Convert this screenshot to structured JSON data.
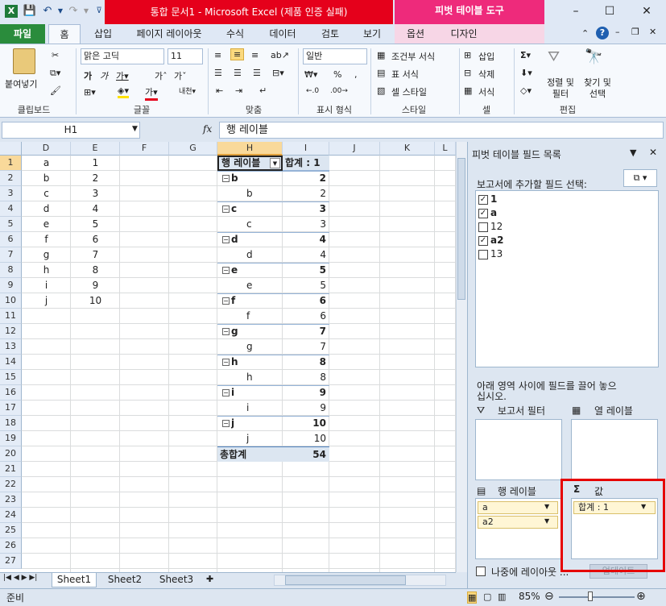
{
  "window": {
    "title": "통합 문서1 - Microsoft Excel (제품 인증 실패)",
    "contextual_tool_title": "피벗 테이블 도구",
    "min_label": "–",
    "max_label": "☐",
    "close_label": "✕"
  },
  "tabs": {
    "file": "파일",
    "home": "홈",
    "insert": "삽입",
    "page_layout": "페이지 레이아웃",
    "formulas": "수식",
    "data": "데이터",
    "review": "검토",
    "view": "보기",
    "options": "옵션",
    "design": "디자인"
  },
  "ribbon": {
    "paste": "붙여넣기",
    "font_name": "맑은 고딕",
    "font_size": "11",
    "number_format": "일반",
    "conditional_format": "조건부 서식",
    "table_format": "표 서식",
    "cell_style": "셀 스타일",
    "insert_cells": "삽입",
    "delete_cells": "삭제",
    "format_cells": "서식",
    "sort_filter": "정렬 및 필터",
    "find_select": "찾기 및 선택",
    "groups": {
      "clipboard": "클립보드",
      "font": "글꼴",
      "alignment": "맞춤",
      "number": "표시 형식",
      "styles": "스타일",
      "cells": "셀",
      "editing": "편집"
    }
  },
  "formula_bar": {
    "name_box": "H1",
    "fx": "fx",
    "content": "행 레이블"
  },
  "grid": {
    "columns": [
      "D",
      "E",
      "F",
      "G",
      "H",
      "I",
      "J",
      "K",
      "L"
    ],
    "rows": [
      "1",
      "2",
      "3",
      "4",
      "5",
      "6",
      "7",
      "8",
      "9",
      "10",
      "11",
      "12",
      "13",
      "14",
      "15",
      "16",
      "17",
      "18",
      "19",
      "20",
      "21",
      "22",
      "23",
      "24",
      "25",
      "26",
      "27"
    ],
    "col_d": [
      "a",
      "b",
      "c",
      "d",
      "e",
      "f",
      "g",
      "h",
      "i",
      "j"
    ],
    "col_e": [
      "1",
      "2",
      "3",
      "4",
      "5",
      "6",
      "7",
      "8",
      "9",
      "10"
    ],
    "pivot_header_label": "행 레이블",
    "pivot_header_value": "합계 : 1",
    "pivot_rows": [
      {
        "label": "b",
        "value": "2",
        "bold": true
      },
      {
        "label": "b",
        "value": "2",
        "bold": false
      },
      {
        "label": "c",
        "value": "3",
        "bold": true
      },
      {
        "label": "c",
        "value": "3",
        "bold": false
      },
      {
        "label": "d",
        "value": "4",
        "bold": true
      },
      {
        "label": "d",
        "value": "4",
        "bold": false
      },
      {
        "label": "e",
        "value": "5",
        "bold": true
      },
      {
        "label": "e",
        "value": "5",
        "bold": false
      },
      {
        "label": "f",
        "value": "6",
        "bold": true
      },
      {
        "label": "f",
        "value": "6",
        "bold": false
      },
      {
        "label": "g",
        "value": "7",
        "bold": true
      },
      {
        "label": "g",
        "value": "7",
        "bold": false
      },
      {
        "label": "h",
        "value": "8",
        "bold": true
      },
      {
        "label": "h",
        "value": "8",
        "bold": false
      },
      {
        "label": "i",
        "value": "9",
        "bold": true
      },
      {
        "label": "i",
        "value": "9",
        "bold": false
      },
      {
        "label": "j",
        "value": "10",
        "bold": true
      },
      {
        "label": "j",
        "value": "10",
        "bold": false
      }
    ],
    "grand_total_label": "총합계",
    "grand_total_value": "54"
  },
  "sheets": [
    "Sheet1",
    "Sheet2",
    "Sheet3"
  ],
  "status": {
    "ready": "준비",
    "zoom": "85%"
  },
  "pivot_pane": {
    "title": "피벗 테이블 필드 목록",
    "choose_fields": "보고서에 추가할 필드 선택:",
    "fields": [
      {
        "name": "1",
        "checked": true
      },
      {
        "name": "a",
        "checked": true
      },
      {
        "name": "12",
        "checked": false
      },
      {
        "name": "a2",
        "checked": true
      },
      {
        "name": "13",
        "checked": false
      }
    ],
    "drag_hint": "아래 영역 사이에 필드를 끌어 놓으십시오.",
    "report_filter": "보고서 필터",
    "column_labels": "열 레이블",
    "row_labels": "행 레이블",
    "values": "값",
    "row_items": [
      "a",
      "a2"
    ],
    "value_items": [
      "합계 : 1"
    ],
    "defer_update": "나중에 레이아웃 ...",
    "update_button": "업데이트"
  },
  "colors": {
    "title_red": "#e5001b",
    "pivot_tools_pink": "#ee2a7b",
    "file_tab_green": "#2a8c3c",
    "highlight_red": "#e60000"
  }
}
